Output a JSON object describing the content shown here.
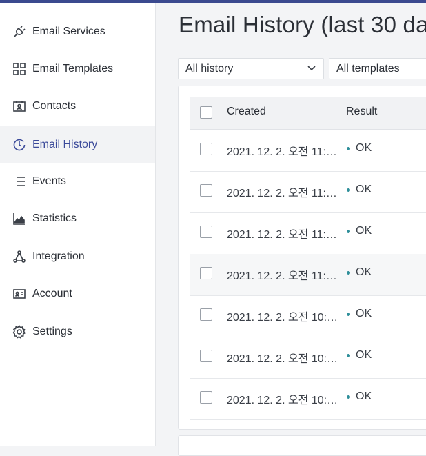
{
  "sidebar": {
    "items": [
      {
        "label": "Email Services",
        "icon": "plug-icon",
        "active": false
      },
      {
        "label": "Email Templates",
        "icon": "templates-grid-icon",
        "active": false
      },
      {
        "label": "Contacts",
        "icon": "contacts-card-icon",
        "active": false
      },
      {
        "label": "Email History",
        "icon": "history-clock-icon",
        "active": true
      },
      {
        "label": "Events",
        "icon": "list-icon",
        "active": false
      },
      {
        "label": "Statistics",
        "icon": "area-chart-icon",
        "active": false
      },
      {
        "label": "Integration",
        "icon": "integration-nodes-icon",
        "active": false
      },
      {
        "label": "Account",
        "icon": "id-card-icon",
        "active": false
      },
      {
        "label": "Settings",
        "icon": "gear-icon",
        "active": false
      }
    ]
  },
  "main": {
    "title": "Email History (last 30 da",
    "filters": {
      "history": "All history",
      "templates": "All templates"
    },
    "table": {
      "columns": [
        "Created",
        "Result"
      ],
      "rows": [
        {
          "created": "2021. 12. 2. 오전 11:3…",
          "result": "OK"
        },
        {
          "created": "2021. 12. 2. 오전 11:1…",
          "result": "OK"
        },
        {
          "created": "2021. 12. 2. 오전 11:1…",
          "result": "OK"
        },
        {
          "created": "2021. 12. 2. 오전 11:1…",
          "result": "OK"
        },
        {
          "created": "2021. 12. 2. 오전 10:3…",
          "result": "OK"
        },
        {
          "created": "2021. 12. 2. 오전 10:1…",
          "result": "OK"
        },
        {
          "created": "2021. 12. 2. 오전 10:0…",
          "result": "OK"
        }
      ]
    }
  },
  "colors": {
    "accent": "#3b4a8f",
    "status_ok": "#2f8f9a"
  }
}
